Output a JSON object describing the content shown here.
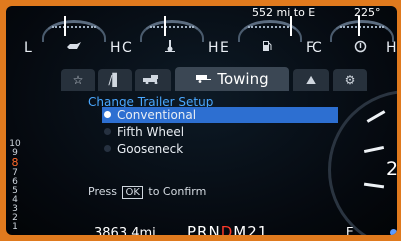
{
  "gauges": {
    "oil": {
      "low": "L",
      "high": "H",
      "icon": "oil-can-icon"
    },
    "coolant": {
      "low": "C",
      "high": "H",
      "icon": "thermometer-icon"
    },
    "fuel": {
      "readout": "552 mi to E",
      "low": "E",
      "high": "F",
      "icon": "fuel-pump-icon"
    },
    "trans": {
      "readout": "225°",
      "low": "C",
      "high": "H",
      "icon": "gear-temp-icon"
    }
  },
  "tabs": [
    {
      "icon": "star-icon",
      "label": "☆"
    },
    {
      "icon": "road-icon",
      "label": "/▌"
    },
    {
      "icon": "truck-icon",
      "label": "🚙"
    },
    {
      "icon": "trailer-icon",
      "label": "Towing"
    },
    {
      "icon": "offroad-icon",
      "label": "⛰"
    },
    {
      "icon": "settings-icon",
      "label": "⚙"
    }
  ],
  "trailer_setup": {
    "title": "Change Trailer Setup",
    "options": [
      {
        "label": "Conventional",
        "selected": true
      },
      {
        "label": "Fifth Wheel",
        "selected": false
      },
      {
        "label": "Gooseneck",
        "selected": false
      }
    ],
    "confirm_prefix": "Press",
    "confirm_key": "OK",
    "confirm_suffix": "to Confirm"
  },
  "gear_scale": [
    "10",
    "9",
    "8",
    "7",
    "6",
    "5",
    "4",
    "3",
    "2",
    "1"
  ],
  "current_gear_scale": "8",
  "speedometer": {
    "visible_numeral": "2"
  },
  "status": {
    "odometer": "3863.4mi",
    "prnd": "PRN",
    "drive": "D",
    "mode": "M21",
    "range_end": "E"
  },
  "colors": {
    "frame": "#e07a1e",
    "selected": "#2d6fd1",
    "title": "#4aa8ff",
    "drive_indicator": "#ff3a2a"
  }
}
